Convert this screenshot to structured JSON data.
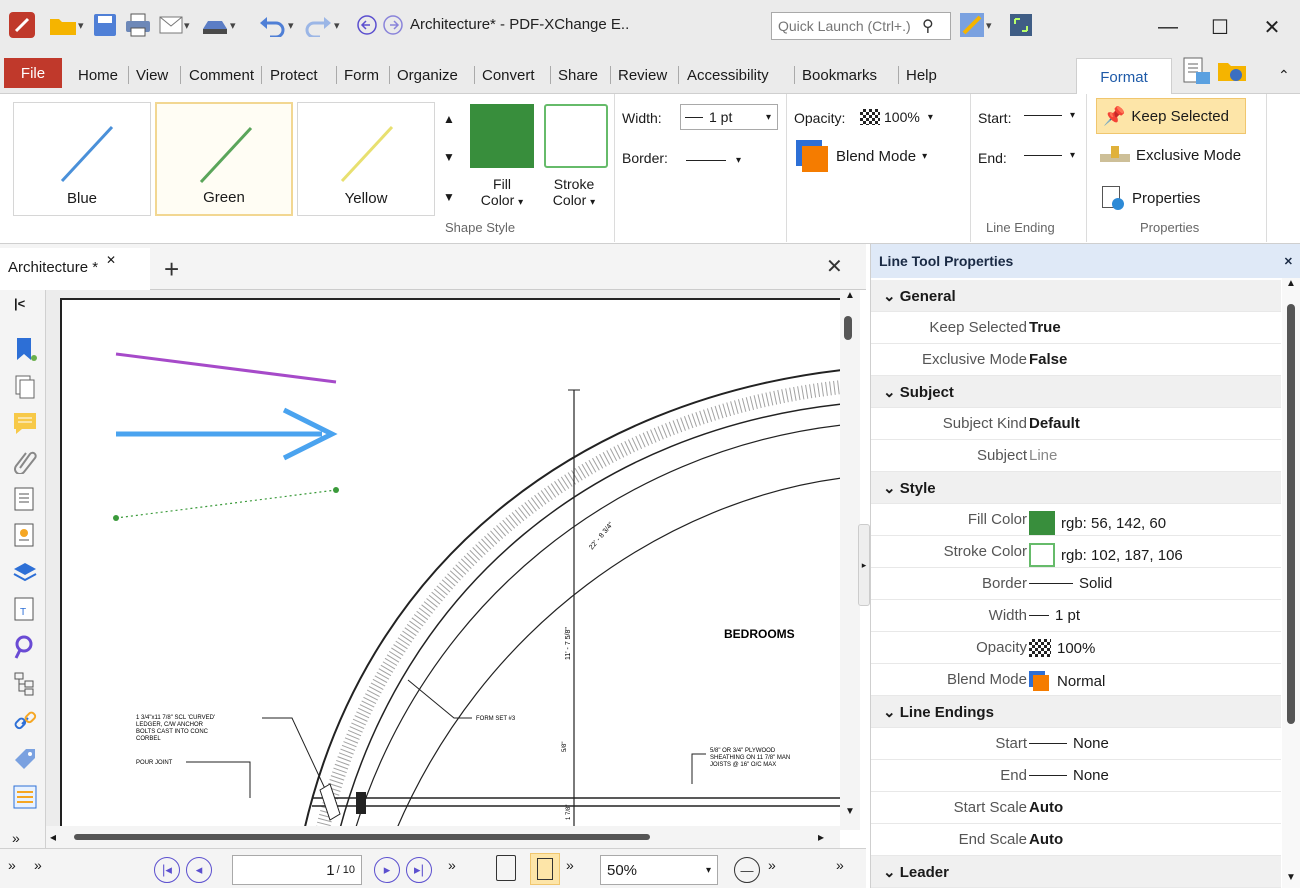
{
  "window": {
    "title": "Architecture* - PDF-XChange E..",
    "quick_launch_placeholder": "Quick Launch (Ctrl+.)",
    "minimize": "—",
    "maximize": "☐",
    "close": "✕"
  },
  "menu": {
    "file": "File",
    "items": [
      "Home",
      "View",
      "Comment",
      "Protect",
      "Form",
      "Organize",
      "Convert",
      "Share",
      "Review",
      "Accessibility",
      "Bookmarks",
      "Help"
    ],
    "active_tab": "Format"
  },
  "ribbon": {
    "styles": [
      {
        "label": "Blue",
        "color": "#4a90d9"
      },
      {
        "label": "Green",
        "color": "#5aa55a"
      },
      {
        "label": "Yellow",
        "color": "#e8e070"
      }
    ],
    "fill_color_label": "Fill Color",
    "fill_color_word1": "Fill",
    "fill_color_word2": "Color",
    "stroke_color_word1": "Stroke",
    "stroke_color_word2": "Color",
    "fill_hex": "#388e3c",
    "stroke_hex": "#66bb6a",
    "shape_style_group": "Shape Style",
    "width_label": "Width:",
    "width_value": "1 pt",
    "border_label": "Border:",
    "opacity_label": "Opacity:",
    "opacity_value": "100%",
    "blend_mode": "Blend Mode",
    "start_label": "Start:",
    "end_label": "End:",
    "line_ending_group": "Line Ending",
    "keep_selected": "Keep Selected",
    "exclusive_mode": "Exclusive Mode",
    "properties": "Properties",
    "properties_group": "Properties"
  },
  "document": {
    "tab_title": "Architecture *",
    "bedrooms": "BEDROOMS",
    "dim_1": "11' - 7 5/8\"",
    "dim_2": "22' - 8 3/4\"",
    "note_ledger": [
      "1 3/4\"x11 7/8\" SCL 'CURVED'",
      "LEDGER, C/W ANCHOR",
      "BOLTS CAST INTO CONC",
      "CORBEL"
    ],
    "note_pour": "POUR JOINT",
    "note_form": "FORM SET #3",
    "note_sheathing": [
      "5/8\" OR 3/4\" PLYWOOD",
      "SHEATHING ON 11 7/8\" MAN",
      "JOISTS @ 16\" O/C MAX"
    ],
    "dim_small_1": "5/8\"",
    "dim_small_2": "1 7/8\""
  },
  "navigation": {
    "page_current": "1",
    "page_total": "/ 10",
    "zoom": "50%"
  },
  "properties_pane": {
    "title": "Line Tool Properties",
    "sections": {
      "general": "General",
      "subject": "Subject",
      "style": "Style",
      "line_endings": "Line Endings",
      "leader": "Leader"
    },
    "rows": {
      "keep_selected": {
        "label": "Keep Selected",
        "value": "True"
      },
      "exclusive_mode": {
        "label": "Exclusive Mode",
        "value": "False"
      },
      "subject_kind": {
        "label": "Subject Kind",
        "value": "Default"
      },
      "subject": {
        "label": "Subject",
        "value": "Line"
      },
      "fill_color": {
        "label": "Fill Color",
        "value": "rgb: 56, 142, 60"
      },
      "stroke_color": {
        "label": "Stroke Color",
        "value": "rgb: 102, 187, 106"
      },
      "border": {
        "label": "Border",
        "value": "Solid"
      },
      "width": {
        "label": "Width",
        "value": "1 pt"
      },
      "opacity": {
        "label": "Opacity",
        "value": "100%"
      },
      "blend_mode": {
        "label": "Blend Mode",
        "value": "Normal"
      },
      "start": {
        "label": "Start",
        "value": "None"
      },
      "end": {
        "label": "End",
        "value": "None"
      },
      "start_scale": {
        "label": "Start Scale",
        "value": "Auto"
      },
      "end_scale": {
        "label": "End Scale",
        "value": "Auto"
      }
    }
  }
}
